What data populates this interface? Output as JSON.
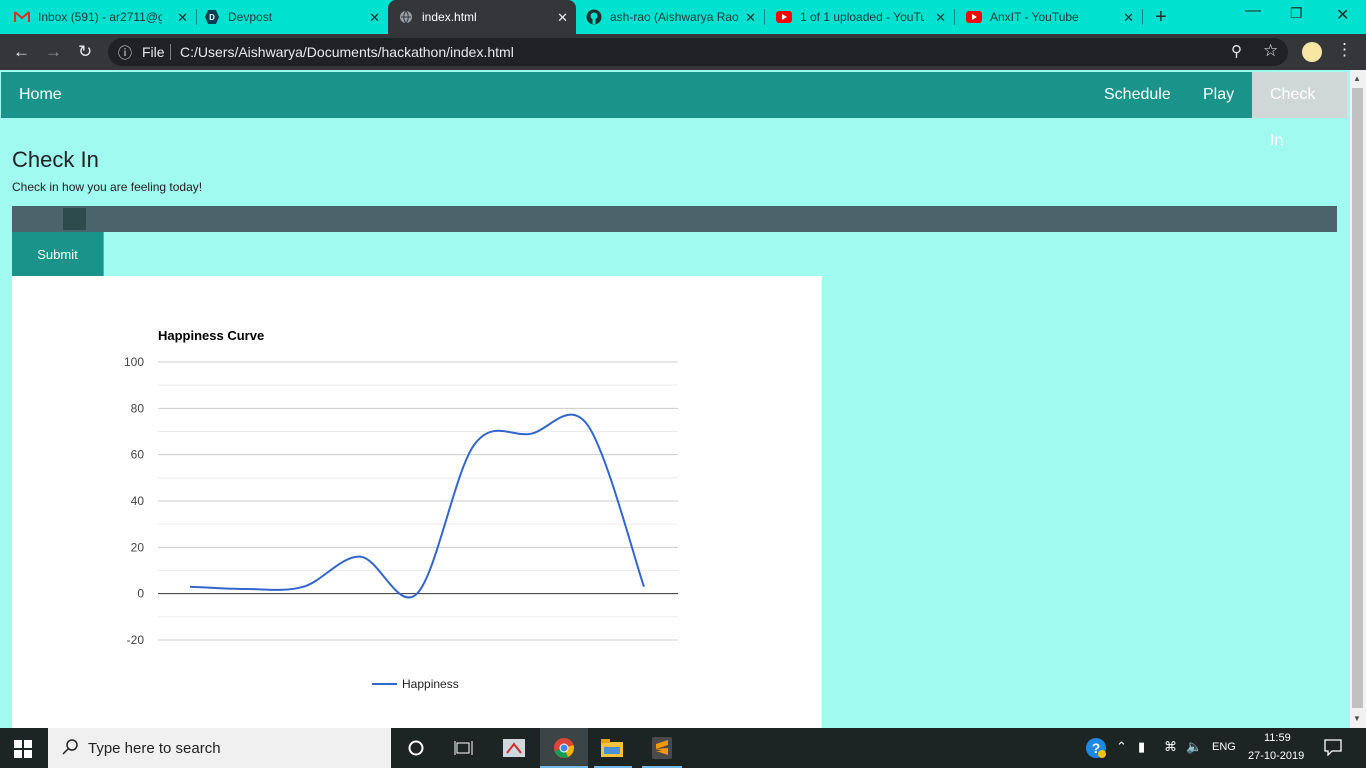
{
  "browser": {
    "tabs": [
      {
        "title": "Inbox (591) - ar2711@g",
        "icon": "gmail-icon"
      },
      {
        "title": "Devpost",
        "icon": "devpost-icon"
      },
      {
        "title": "index.html",
        "icon": "globe-icon"
      },
      {
        "title": "ash-rao (Aishwarya Rao",
        "icon": "github-icon"
      },
      {
        "title": "1 of 1 uploaded - YouTu",
        "icon": "youtube-icon"
      },
      {
        "title": "AnxIT - YouTube",
        "icon": "youtube-icon"
      }
    ],
    "active_tab": 2,
    "address": {
      "scheme_label": "File",
      "url": "C:/Users/Aishwarya/Documents/hackathon/index.html"
    },
    "close_glyph": "✕",
    "new_tab_glyph": "+"
  },
  "nav": {
    "home": "Home",
    "schedule": "Schedule",
    "play": "Play",
    "checkin": "Check In",
    "active": "checkin"
  },
  "checkin": {
    "title": "Check In",
    "subtitle": "Check in how you are feeling today!",
    "slider_value_fraction": 0.05,
    "submit_label": "Submit"
  },
  "chart_data": {
    "type": "line",
    "title": "Happiness Curve",
    "x": [
      0,
      1,
      2,
      3,
      4,
      5,
      6,
      7,
      8
    ],
    "series": [
      {
        "name": "Happiness",
        "values": [
          3,
          2,
          3,
          16,
          0,
          64,
          69,
          73,
          3
        ],
        "color": "#3366cc"
      }
    ],
    "ylim": [
      -20,
      100
    ],
    "yticks": [
      "100",
      "80",
      "60",
      "40",
      "20",
      "0",
      "-20"
    ],
    "grid": true,
    "legend": "bottom",
    "smooth": true
  },
  "taskbar": {
    "search_placeholder": "Type here to search",
    "lang": "ENG",
    "time": "11:59",
    "date": "27-10-2019"
  },
  "colors": {
    "tabstrip": "#00e1d0",
    "navbar": "#1a938a",
    "page_bg": "#a0faf0",
    "line": "#3366cc"
  }
}
